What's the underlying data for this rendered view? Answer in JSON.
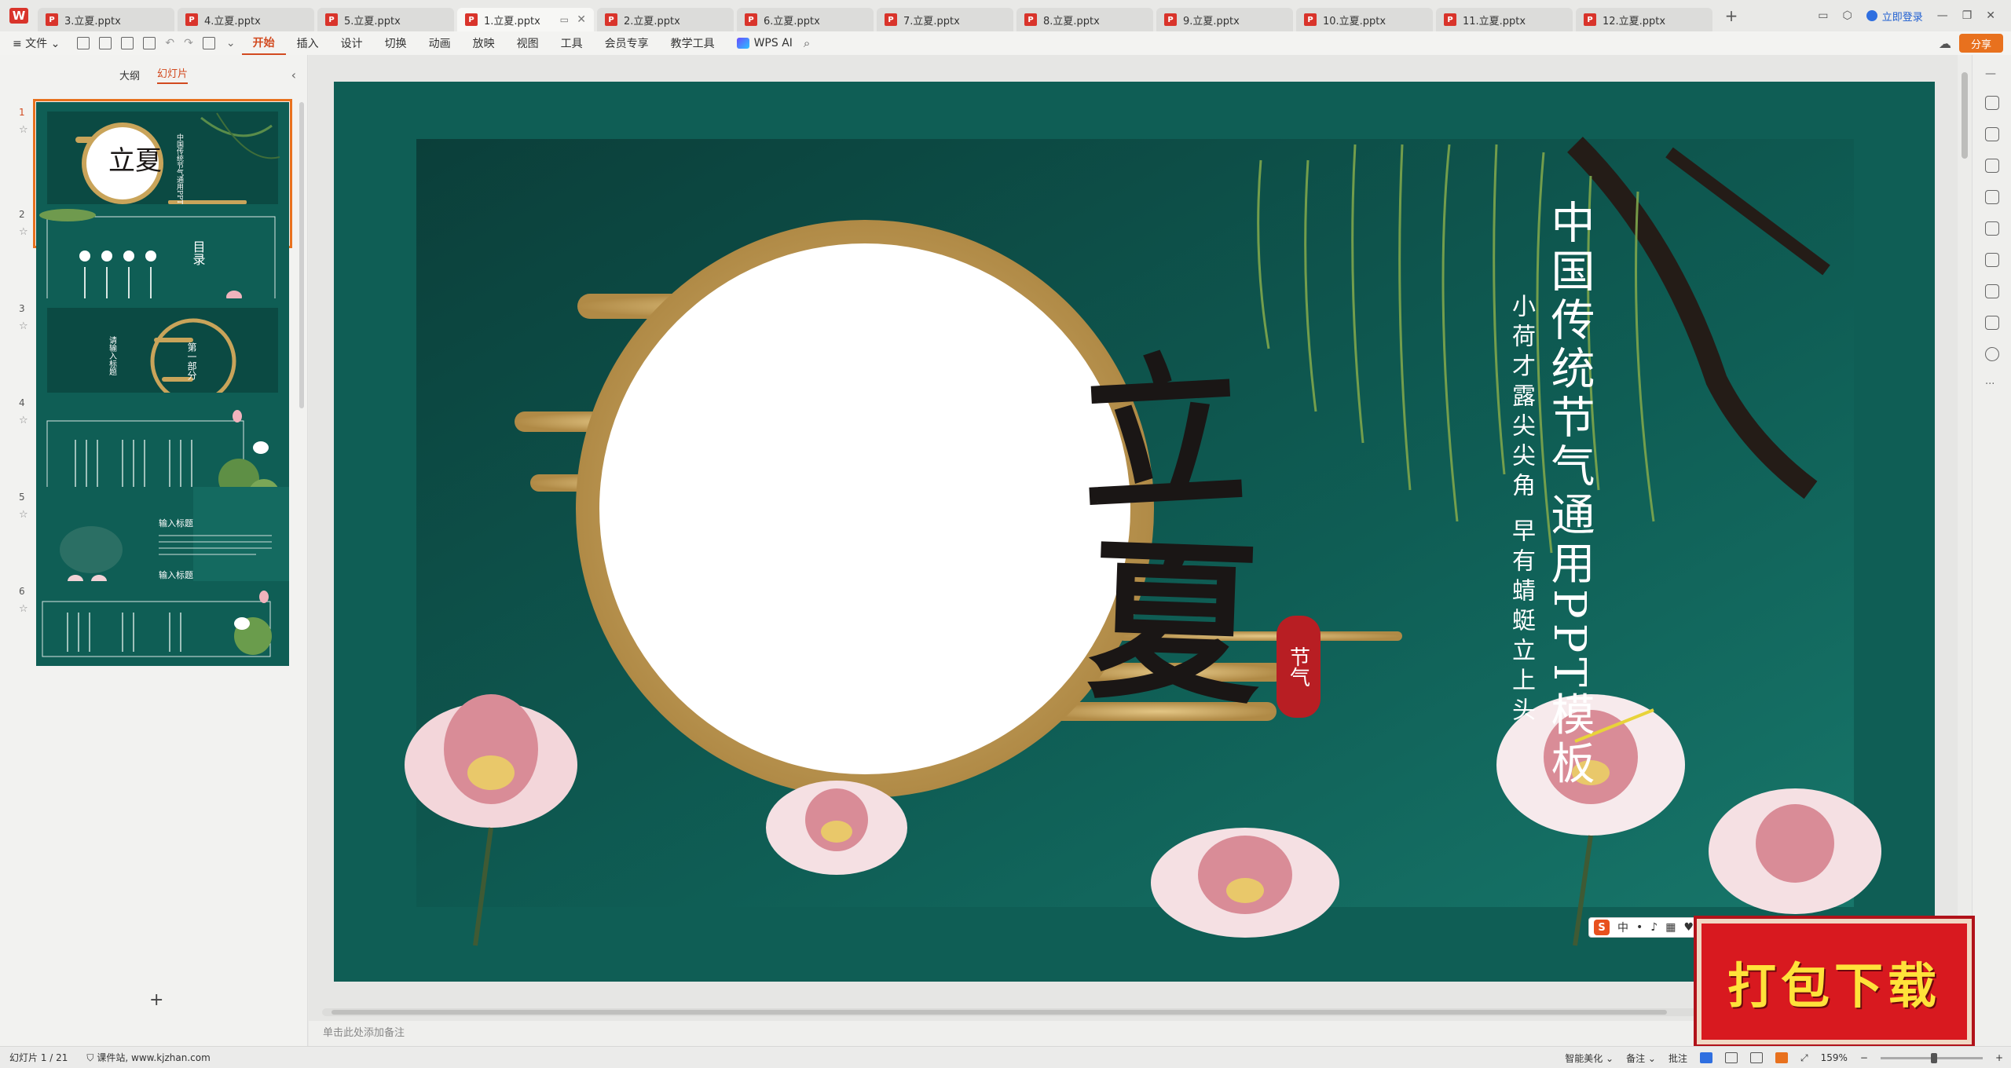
{
  "app": {
    "logo_letter": "W",
    "tabs": [
      {
        "label": "3.立夏.pptx",
        "active": false
      },
      {
        "label": "4.立夏.pptx",
        "active": false
      },
      {
        "label": "5.立夏.pptx",
        "active": false
      },
      {
        "label": "1.立夏.pptx",
        "active": true
      },
      {
        "label": "2.立夏.pptx",
        "active": false
      },
      {
        "label": "6.立夏.pptx",
        "active": false
      },
      {
        "label": "7.立夏.pptx",
        "active": false
      },
      {
        "label": "8.立夏.pptx",
        "active": false
      },
      {
        "label": "9.立夏.pptx",
        "active": false
      },
      {
        "label": "10.立夏.pptx",
        "active": false
      },
      {
        "label": "11.立夏.pptx",
        "active": false
      },
      {
        "label": "12.立夏.pptx",
        "active": false
      }
    ],
    "tab_plus": "+",
    "login_label": "立即登录",
    "share_label": "分享"
  },
  "menu": {
    "file": "≡ 文件 ⌄",
    "items": [
      "开始",
      "插入",
      "设计",
      "切换",
      "动画",
      "放映",
      "视图",
      "工具",
      "会员专享",
      "教学工具"
    ],
    "active_index": 0,
    "wps_ai": "WPS AI"
  },
  "left_panel": {
    "tab_outline": "大纲",
    "tab_slides": "幻灯片",
    "slide_numbers": [
      "1",
      "2",
      "3",
      "4",
      "5",
      "6"
    ],
    "selected_slide": 1,
    "add_label": "+",
    "thumb_texts": {
      "t1_title": "立夏",
      "t2_toc": "目录",
      "t3_part": "第一部分",
      "t3_heading": "请输入标题",
      "t5_heading_a": "输入标题",
      "t5_heading_b": "输入标题"
    }
  },
  "slide": {
    "main_title": "中国传统节气通用PPT模板",
    "subtitle_1": "小荷才露尖尖角",
    "subtitle_2": "早有蜻蜓立上头",
    "calligraphy_1": "立",
    "calligraphy_2": "夏",
    "seal_text": "节气",
    "colors": {
      "bg": "#0e5a52",
      "gold": "#c9a45a",
      "circle": "#ffffff",
      "seal": "#b81e23"
    }
  },
  "notes_placeholder": "单击此处添加备注",
  "status": {
    "slide_counter": "幻灯片 1 / 21",
    "site": "课件站, www.kjzhan.com",
    "beautify": "智能美化 ⌄",
    "notes": "备注 ⌄",
    "comments": "批注",
    "zoom": "159%"
  },
  "banner": {
    "text": "打包下载"
  },
  "ime": {
    "brand": "S",
    "mode": "中"
  }
}
